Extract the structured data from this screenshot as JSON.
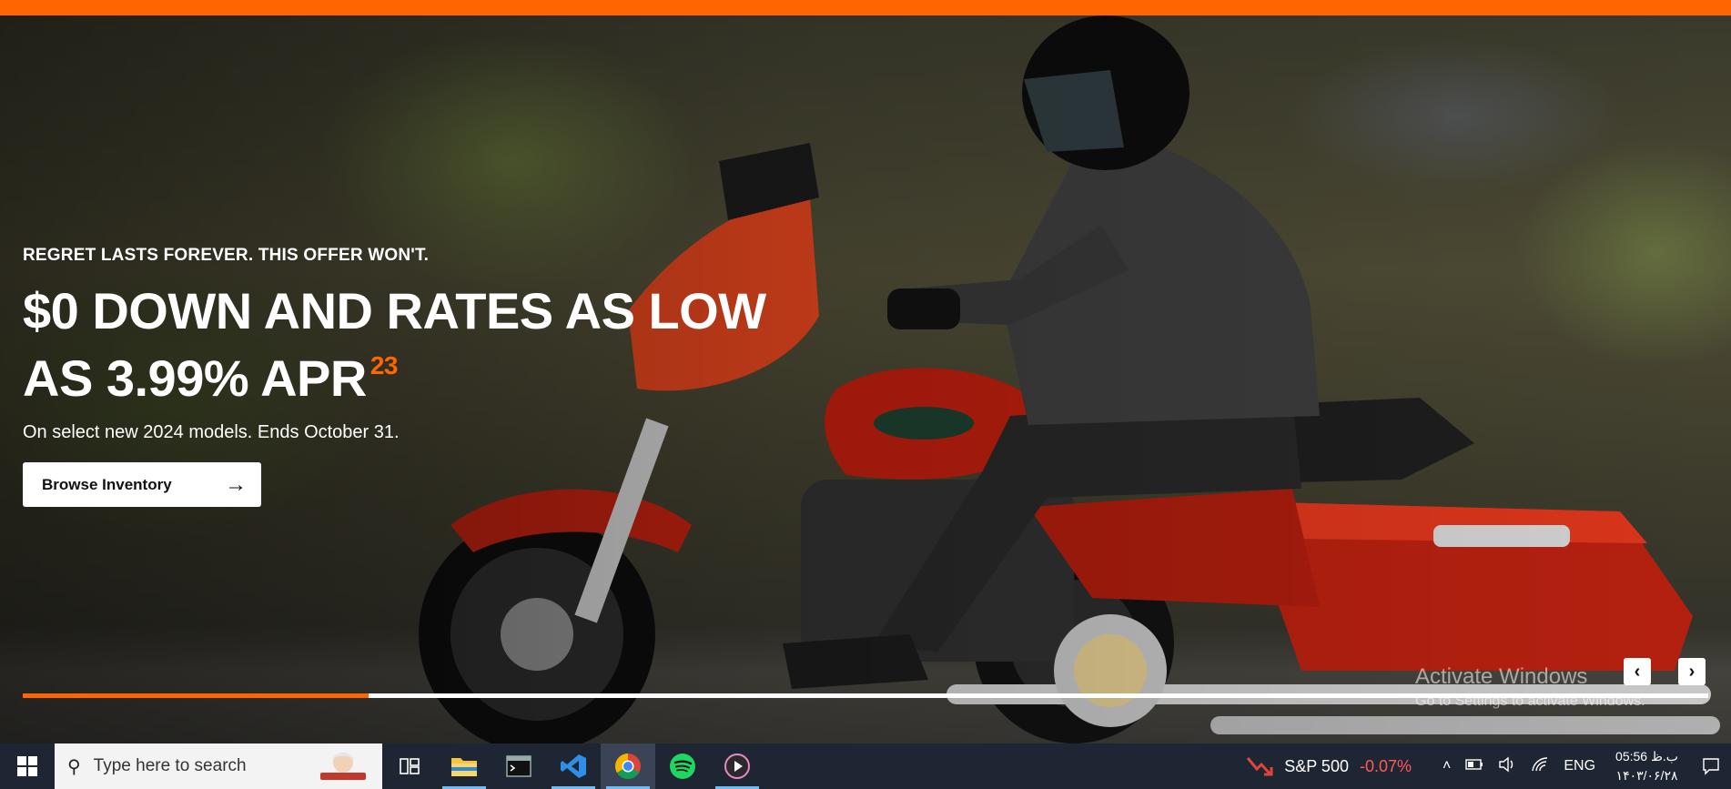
{
  "hero": {
    "eyebrow": "REGRET LASTS FOREVER. THIS OFFER WON'T.",
    "headline_line1": "$0 DOWN AND RATES AS LOW",
    "headline_line2": "AS 3.99% APR",
    "footnote": "23",
    "subline": "On select new 2024 models. Ends October 31.",
    "cta_label": "Browse Inventory",
    "cta_icon": "arrow-right-icon",
    "carousel_progress": 0.205,
    "accent_color": "#ff6600"
  },
  "watermark": {
    "title": "Activate Windows",
    "subtitle": "Go to Settings to activate Windows."
  },
  "taskbar": {
    "search_placeholder": "Type here to search",
    "apps": [
      "task-view",
      "file-explorer",
      "terminal",
      "vs-code",
      "chrome",
      "spotify",
      "media-player"
    ],
    "stock_name": "S&P 500",
    "stock_change": "-0.07%",
    "language": "ENG",
    "time": "05:56 ب.ظ",
    "date": "۱۴۰۳/۰۶/۲۸"
  }
}
